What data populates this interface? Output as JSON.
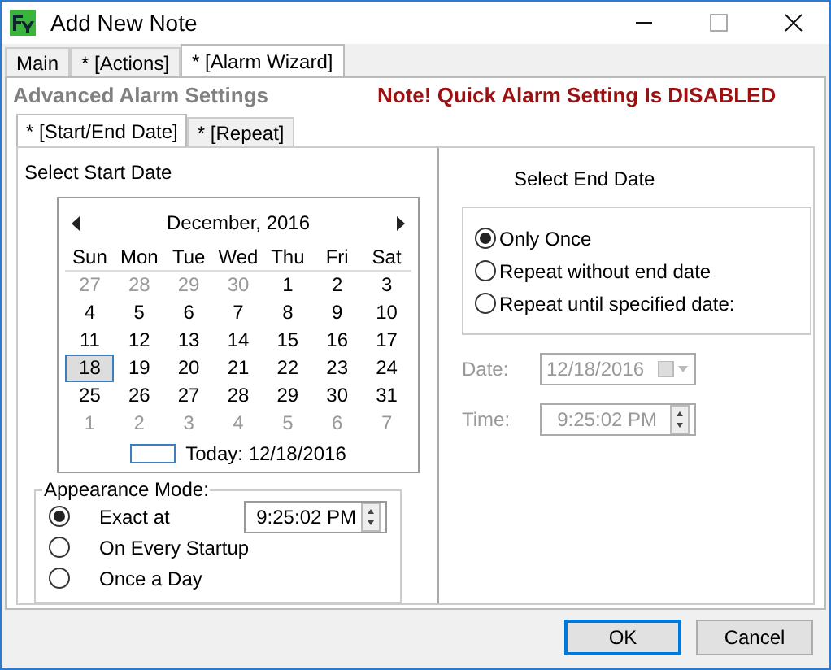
{
  "window": {
    "title": "Add New Note"
  },
  "tabs": [
    {
      "label": "Main",
      "selected": false
    },
    {
      "label": "* [Actions]",
      "selected": false
    },
    {
      "label": "* [Alarm Wizard]",
      "selected": true
    }
  ],
  "section_title": "Advanced Alarm Settings",
  "warning": "Note! Quick Alarm Setting Is DISABLED",
  "subtabs": [
    {
      "label": "* [Start/End Date]",
      "selected": true
    },
    {
      "label": "* [Repeat]",
      "selected": false
    }
  ],
  "start": {
    "label": "Select Start Date",
    "calendar": {
      "month_label": "December, 2016",
      "weekdays": [
        "Sun",
        "Mon",
        "Tue",
        "Wed",
        "Thu",
        "Fri",
        "Sat"
      ],
      "weeks": [
        [
          {
            "day": "27",
            "muted": true,
            "selected": false
          },
          {
            "day": "28",
            "muted": true,
            "selected": false
          },
          {
            "day": "29",
            "muted": true,
            "selected": false
          },
          {
            "day": "30",
            "muted": true,
            "selected": false
          },
          {
            "day": "1",
            "muted": false,
            "selected": false
          },
          {
            "day": "2",
            "muted": false,
            "selected": false
          },
          {
            "day": "3",
            "muted": false,
            "selected": false
          }
        ],
        [
          {
            "day": "4",
            "muted": false,
            "selected": false
          },
          {
            "day": "5",
            "muted": false,
            "selected": false
          },
          {
            "day": "6",
            "muted": false,
            "selected": false
          },
          {
            "day": "7",
            "muted": false,
            "selected": false
          },
          {
            "day": "8",
            "muted": false,
            "selected": false
          },
          {
            "day": "9",
            "muted": false,
            "selected": false
          },
          {
            "day": "10",
            "muted": false,
            "selected": false
          }
        ],
        [
          {
            "day": "11",
            "muted": false,
            "selected": false
          },
          {
            "day": "12",
            "muted": false,
            "selected": false
          },
          {
            "day": "13",
            "muted": false,
            "selected": false
          },
          {
            "day": "14",
            "muted": false,
            "selected": false
          },
          {
            "day": "15",
            "muted": false,
            "selected": false
          },
          {
            "day": "16",
            "muted": false,
            "selected": false
          },
          {
            "day": "17",
            "muted": false,
            "selected": false
          }
        ],
        [
          {
            "day": "18",
            "muted": false,
            "selected": true
          },
          {
            "day": "19",
            "muted": false,
            "selected": false
          },
          {
            "day": "20",
            "muted": false,
            "selected": false
          },
          {
            "day": "21",
            "muted": false,
            "selected": false
          },
          {
            "day": "22",
            "muted": false,
            "selected": false
          },
          {
            "day": "23",
            "muted": false,
            "selected": false
          },
          {
            "day": "24",
            "muted": false,
            "selected": false
          }
        ],
        [
          {
            "day": "25",
            "muted": false,
            "selected": false
          },
          {
            "day": "26",
            "muted": false,
            "selected": false
          },
          {
            "day": "27",
            "muted": false,
            "selected": false
          },
          {
            "day": "28",
            "muted": false,
            "selected": false
          },
          {
            "day": "29",
            "muted": false,
            "selected": false
          },
          {
            "day": "30",
            "muted": false,
            "selected": false
          },
          {
            "day": "31",
            "muted": false,
            "selected": false
          }
        ],
        [
          {
            "day": "1",
            "muted": true,
            "selected": false
          },
          {
            "day": "2",
            "muted": true,
            "selected": false
          },
          {
            "day": "3",
            "muted": true,
            "selected": false
          },
          {
            "day": "4",
            "muted": true,
            "selected": false
          },
          {
            "day": "5",
            "muted": true,
            "selected": false
          },
          {
            "day": "6",
            "muted": true,
            "selected": false
          },
          {
            "day": "7",
            "muted": true,
            "selected": false
          }
        ]
      ],
      "today_label": "Today: 12/18/2016"
    }
  },
  "appearance": {
    "legend": "Appearance Mode:",
    "time_value": "9:25:02 PM",
    "options": [
      {
        "label": "Exact at",
        "selected": true
      },
      {
        "label": "On Every Startup",
        "selected": false
      },
      {
        "label": "Once a Day",
        "selected": false
      }
    ]
  },
  "end": {
    "label": "Select End Date",
    "options": [
      {
        "label": "Only Once",
        "selected": true
      },
      {
        "label": "Repeat without end date",
        "selected": false
      },
      {
        "label": "Repeat until specified date:",
        "selected": false
      }
    ],
    "disabled": true,
    "date_label": "Date:",
    "date_value": "12/18/2016",
    "time_label": "Time:",
    "time_value": "9:25:02 PM"
  },
  "buttons": [
    {
      "label": "OK",
      "default": true
    },
    {
      "label": "Cancel",
      "default": false
    }
  ]
}
